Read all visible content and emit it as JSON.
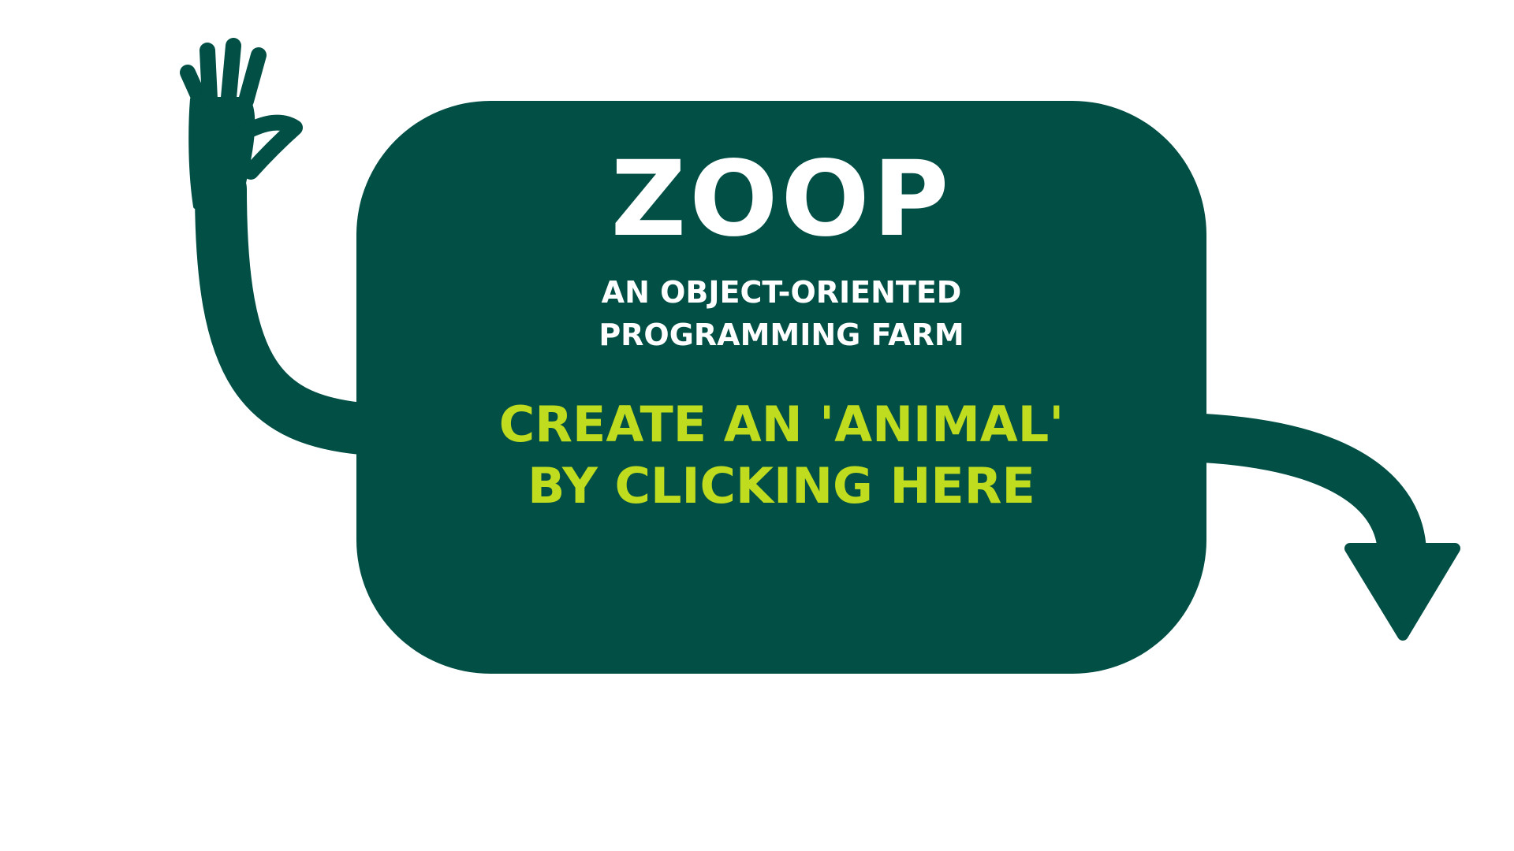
{
  "app": {
    "logo": "ZOOP",
    "tagline_lines": [
      "AN OBJECT-ORIENTED",
      "PROGRAMMING FARM"
    ]
  },
  "cta": {
    "lines": [
      "CREATE AN 'ANIMAL'",
      "BY CLICKING HERE"
    ]
  },
  "decorations": {
    "left": "waving-arm-icon",
    "right": "curved-arrow-icon"
  },
  "colors": {
    "card_bg": "#014f45",
    "logo_text": "#ffffff",
    "cta_text": "#bfdc1e",
    "background": "#ffffff"
  }
}
